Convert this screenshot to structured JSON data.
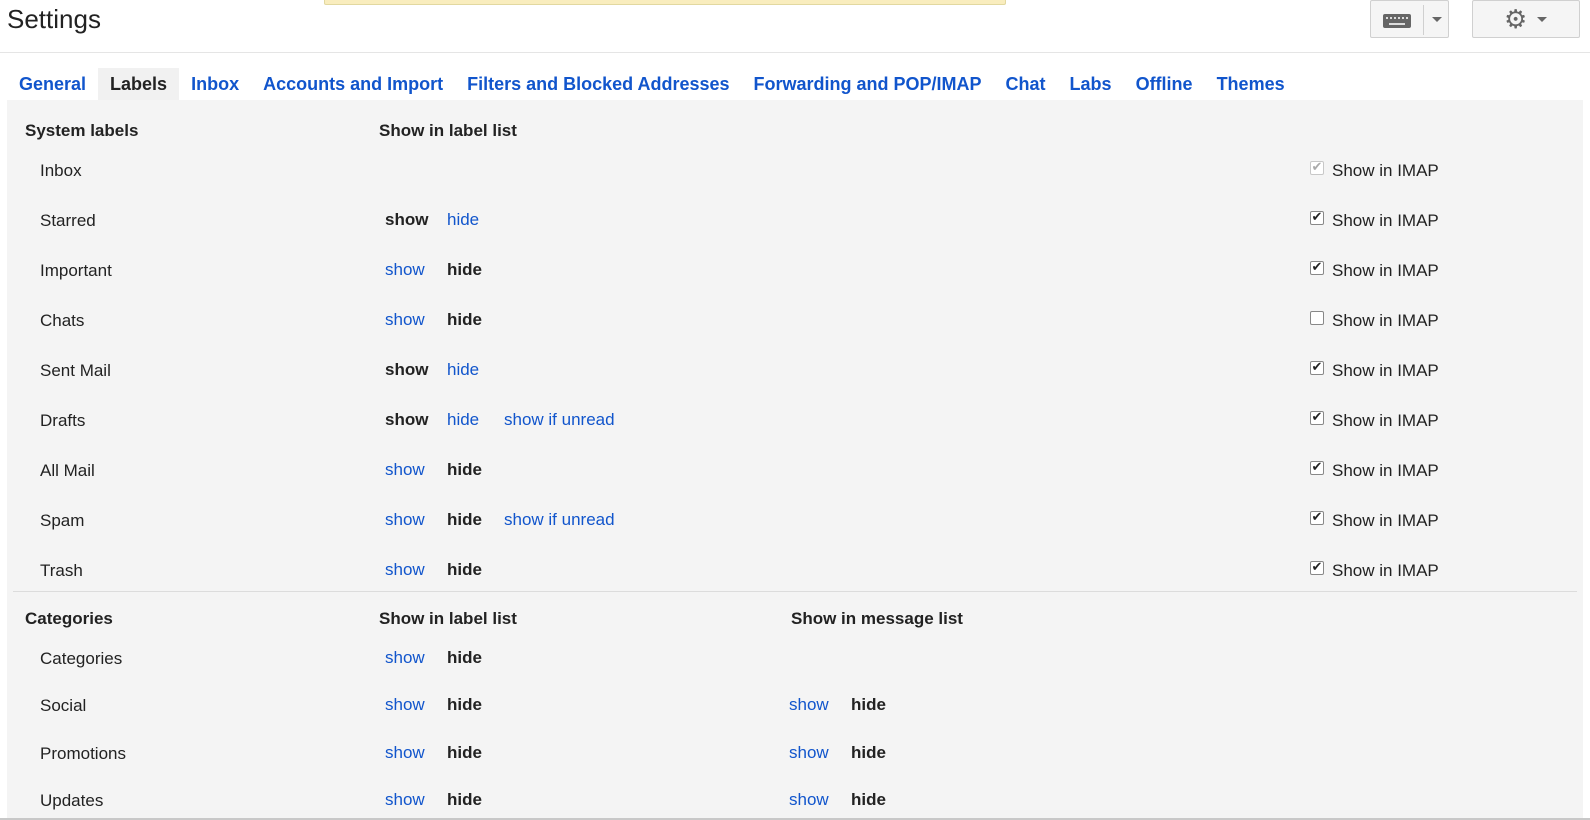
{
  "header": {
    "title": "Settings",
    "keyboard_icon": "keyboard-icon",
    "settings_icon": "gear-icon"
  },
  "tabs": [
    {
      "label": "General",
      "active": false
    },
    {
      "label": "Labels",
      "active": true
    },
    {
      "label": "Inbox",
      "active": false
    },
    {
      "label": "Accounts and Import",
      "active": false
    },
    {
      "label": "Filters and Blocked Addresses",
      "active": false
    },
    {
      "label": "Forwarding and POP/IMAP",
      "active": false
    },
    {
      "label": "Chat",
      "active": false
    },
    {
      "label": "Labs",
      "active": false
    },
    {
      "label": "Offline",
      "active": false
    },
    {
      "label": "Themes",
      "active": false
    }
  ],
  "system_labels": {
    "heading": "System labels",
    "column_heading": "Show in label list",
    "imap_label": "Show in IMAP",
    "rows": [
      {
        "name": "Inbox",
        "options": [],
        "imap_checked": true,
        "imap_disabled": true
      },
      {
        "name": "Starred",
        "options": [
          {
            "text": "show",
            "selected": true
          },
          {
            "text": "hide",
            "selected": false
          }
        ],
        "imap_checked": true,
        "imap_disabled": false
      },
      {
        "name": "Important",
        "options": [
          {
            "text": "show",
            "selected": false
          },
          {
            "text": "hide",
            "selected": true
          }
        ],
        "imap_checked": true,
        "imap_disabled": false
      },
      {
        "name": "Chats",
        "options": [
          {
            "text": "show",
            "selected": false
          },
          {
            "text": "hide",
            "selected": true
          }
        ],
        "imap_checked": false,
        "imap_disabled": false
      },
      {
        "name": "Sent Mail",
        "options": [
          {
            "text": "show",
            "selected": true
          },
          {
            "text": "hide",
            "selected": false
          }
        ],
        "imap_checked": true,
        "imap_disabled": false
      },
      {
        "name": "Drafts",
        "options": [
          {
            "text": "show",
            "selected": true
          },
          {
            "text": "hide",
            "selected": false
          },
          {
            "text": "show if unread",
            "selected": false
          }
        ],
        "imap_checked": true,
        "imap_disabled": false
      },
      {
        "name": "All Mail",
        "options": [
          {
            "text": "show",
            "selected": false
          },
          {
            "text": "hide",
            "selected": true
          }
        ],
        "imap_checked": true,
        "imap_disabled": false
      },
      {
        "name": "Spam",
        "options": [
          {
            "text": "show",
            "selected": false
          },
          {
            "text": "hide",
            "selected": true
          },
          {
            "text": "show if unread",
            "selected": false
          }
        ],
        "imap_checked": true,
        "imap_disabled": false
      },
      {
        "name": "Trash",
        "options": [
          {
            "text": "show",
            "selected": false
          },
          {
            "text": "hide",
            "selected": true
          }
        ],
        "imap_checked": true,
        "imap_disabled": false
      }
    ]
  },
  "categories": {
    "heading": "Categories",
    "label_list_heading": "Show in label list",
    "message_list_heading": "Show in message list",
    "rows": [
      {
        "name": "Categories",
        "label_list": [
          {
            "text": "show",
            "selected": false
          },
          {
            "text": "hide",
            "selected": true
          }
        ],
        "message_list": []
      },
      {
        "name": "Social",
        "label_list": [
          {
            "text": "show",
            "selected": false
          },
          {
            "text": "hide",
            "selected": true
          }
        ],
        "message_list": [
          {
            "text": "show",
            "selected": false
          },
          {
            "text": "hide",
            "selected": true
          }
        ]
      },
      {
        "name": "Promotions",
        "label_list": [
          {
            "text": "show",
            "selected": false
          },
          {
            "text": "hide",
            "selected": true
          }
        ],
        "message_list": [
          {
            "text": "show",
            "selected": false
          },
          {
            "text": "hide",
            "selected": true
          }
        ]
      },
      {
        "name": "Updates",
        "label_list": [
          {
            "text": "show",
            "selected": false
          },
          {
            "text": "hide",
            "selected": true
          }
        ],
        "message_list": [
          {
            "text": "show",
            "selected": false
          },
          {
            "text": "hide",
            "selected": true
          }
        ]
      }
    ]
  },
  "colors": {
    "link": "#1155cc",
    "text": "#222222",
    "panel_bg": "#f4f4f4",
    "notify_bg": "#f9edbe"
  }
}
